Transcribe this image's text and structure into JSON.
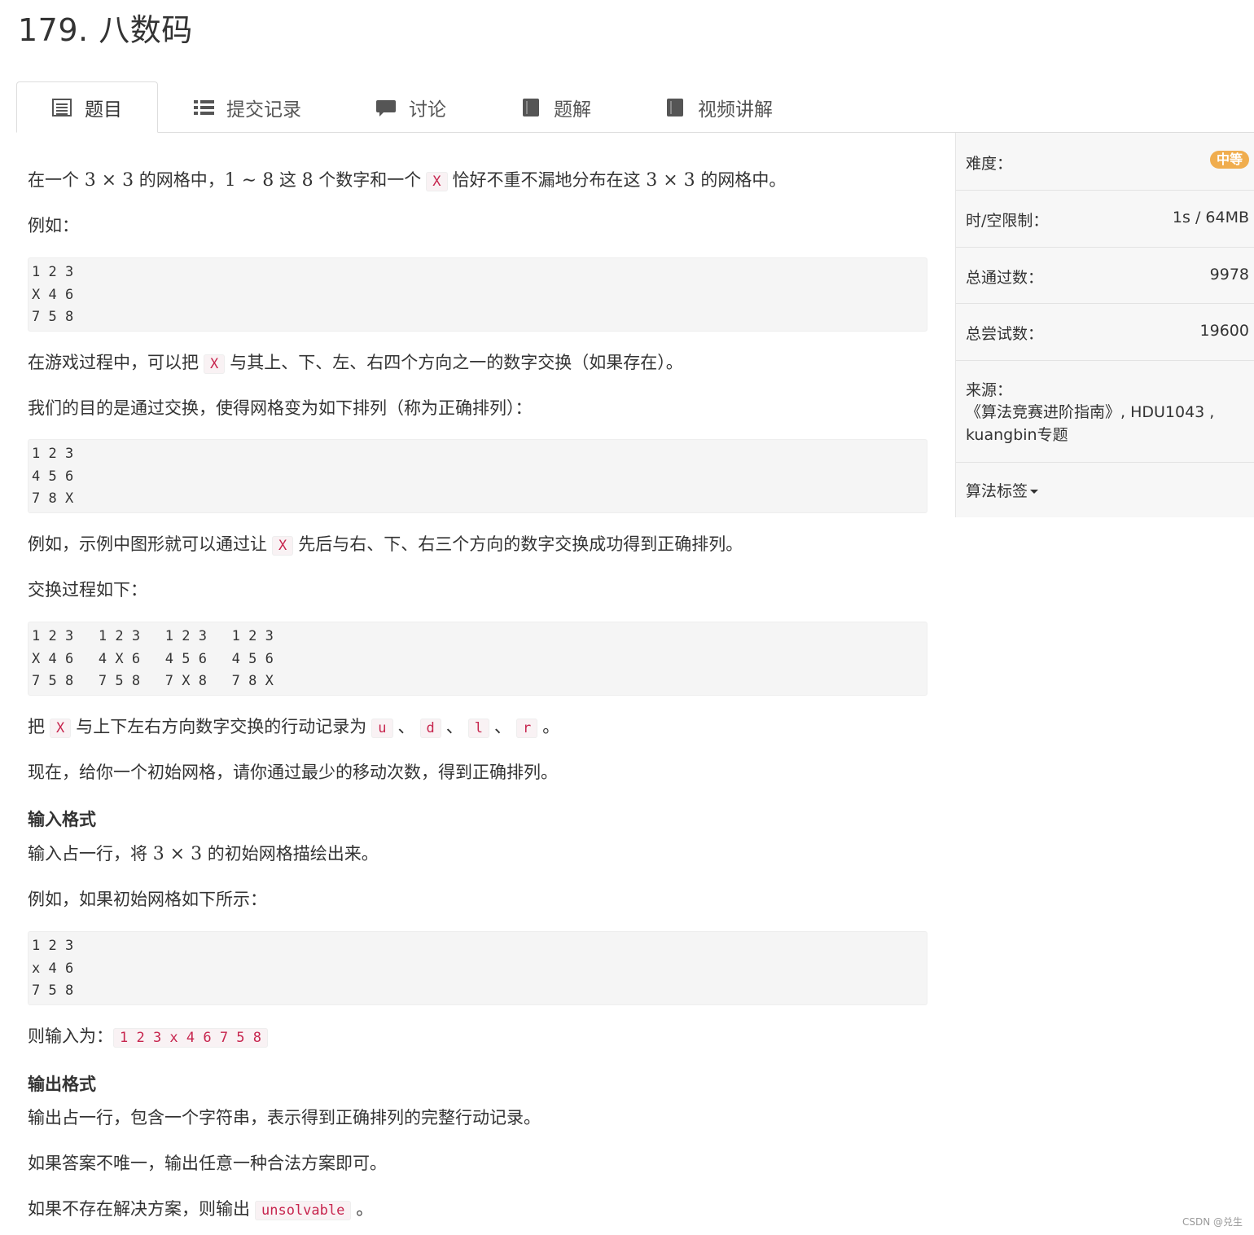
{
  "problem": {
    "title": "179. 八数码"
  },
  "tabs": [
    {
      "label": "题目",
      "icon": "document-icon"
    },
    {
      "label": "提交记录",
      "icon": "list-icon"
    },
    {
      "label": "讨论",
      "icon": "comment-icon"
    },
    {
      "label": "题解",
      "icon": "book-icon"
    },
    {
      "label": "视频讲解",
      "icon": "book-icon"
    }
  ],
  "statement": {
    "p1": {
      "a": "在一个",
      "m1": "3 × 3",
      "b": "的网格中，",
      "m2": "1 ∼ 8",
      "c": "这",
      "m3": "8",
      "d": "个数字和一个",
      "code": "X",
      "e": "恰好不重不漏地分布在这",
      "m4": "3 × 3",
      "f": "的网格中。"
    },
    "p2": "例如：",
    "grid1": "1 2 3\nX 4 6\n7 5 8",
    "p3": {
      "a": "在游戏过程中，可以把",
      "code": "X",
      "b": "与其上、下、左、右四个方向之一的数字交换（如果存在）。"
    },
    "p4": "我们的目的是通过交换，使得网格变为如下排列（称为正确排列）：",
    "grid2": "1 2 3\n4 5 6\n7 8 X",
    "p5": {
      "a": "例如，示例中图形就可以通过让",
      "code": "X",
      "b": "先后与右、下、右三个方向的数字交换成功得到正确排列。"
    },
    "p6": "交换过程如下：",
    "grid3": "1 2 3   1 2 3   1 2 3   1 2 3\nX 4 6   4 X 6   4 5 6   4 5 6\n7 5 8   7 5 8   7 X 8   7 8 X",
    "p7": {
      "a": "把",
      "code": "X",
      "b": "与上下左右方向数字交换的行动记录为",
      "u": "u",
      "sep1": "、",
      "d": "d",
      "sep2": "、",
      "l": "l",
      "sep3": "、",
      "r": "r",
      "end": "。"
    },
    "p8": "现在，给你一个初始网格，请你通过最少的移动次数，得到正确排列。"
  },
  "input_format": {
    "heading": "输入格式",
    "p1": {
      "a": "输入占一行，将",
      "m": "3 × 3",
      "b": "的初始网格描绘出来。"
    },
    "p2": "例如，如果初始网格如下所示：",
    "grid": "1 2 3\nx 4 6\n7 5 8",
    "p3": {
      "a": "则输入为：",
      "code": "1 2 3 x 4 6 7 5 8"
    }
  },
  "output_format": {
    "heading": "输出格式",
    "p1": "输出占一行，包含一个字符串，表示得到正确排列的完整行动记录。",
    "p2": "如果答案不唯一，输出任意一种合法方案即可。",
    "p3": {
      "a": "如果不存在解决方案，则输出",
      "code": "unsolvable",
      "b": "。"
    }
  },
  "sidebar": {
    "difficulty_label": "难度：",
    "difficulty_value": "中等",
    "difficulty_color": "#f0ad4e",
    "limit_label": "时/空限制：",
    "limit_value": "1s / 64MB",
    "passed_label": "总通过数：",
    "passed_value": "9978",
    "tried_label": "总尝试数：",
    "tried_value": "19600",
    "source_label": "来源：",
    "source_line1": "《算法竞赛进阶指南》, HDU1043 ,",
    "source_line2": "kuangbin专题",
    "tags_label": "算法标签"
  },
  "watermark": "CSDN @兑生"
}
